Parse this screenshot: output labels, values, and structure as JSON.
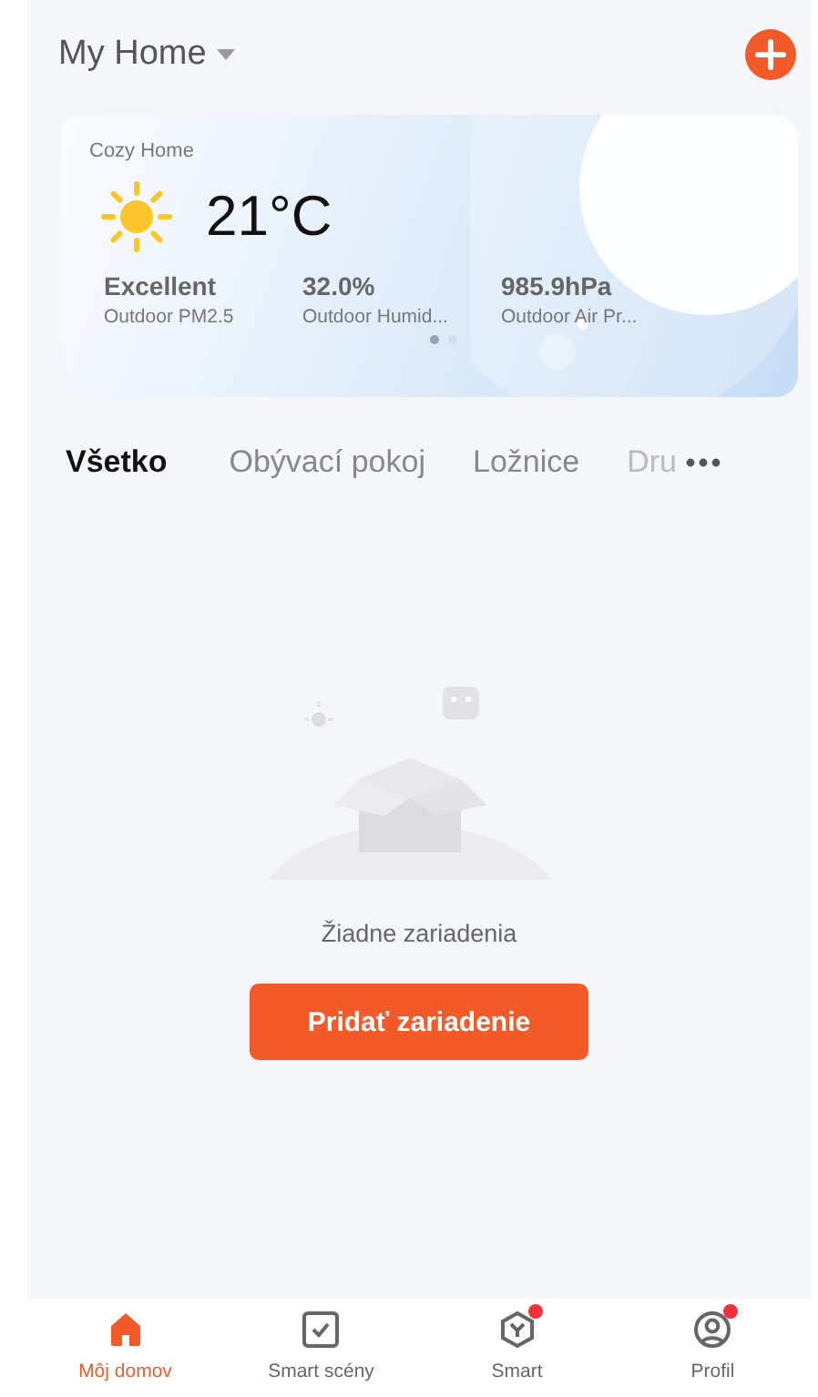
{
  "header": {
    "home_name": "My Home"
  },
  "weather_card": {
    "title": "Cozy Home",
    "temperature": "21°C",
    "stats": [
      {
        "value": "Excellent",
        "label": "Outdoor PM2.5"
      },
      {
        "value": "32.0%",
        "label": "Outdoor Humid..."
      },
      {
        "value": "985.9hPa",
        "label": "Outdoor Air Pr..."
      }
    ],
    "pages": [
      {
        "selected": true
      },
      {
        "selected": false
      }
    ]
  },
  "room_tabs": [
    {
      "label": "Všetko",
      "selected": true
    },
    {
      "label": "Obývací pokoj",
      "selected": false
    },
    {
      "label": "Ložnice",
      "selected": false
    },
    {
      "label": "Dru",
      "selected": false
    }
  ],
  "empty_state": {
    "message": "Žiadne zariadenia",
    "button": "Pridať zariadenie"
  },
  "bottom_nav": [
    {
      "kind": "home",
      "label": "Môj domov",
      "selected": true,
      "badge": false
    },
    {
      "kind": "scenes",
      "label": "Smart scény",
      "selected": false,
      "badge": false
    },
    {
      "kind": "smart",
      "label": "Smart",
      "selected": false,
      "badge": true
    },
    {
      "kind": "profile",
      "label": "Profil",
      "selected": false,
      "badge": true
    }
  ]
}
